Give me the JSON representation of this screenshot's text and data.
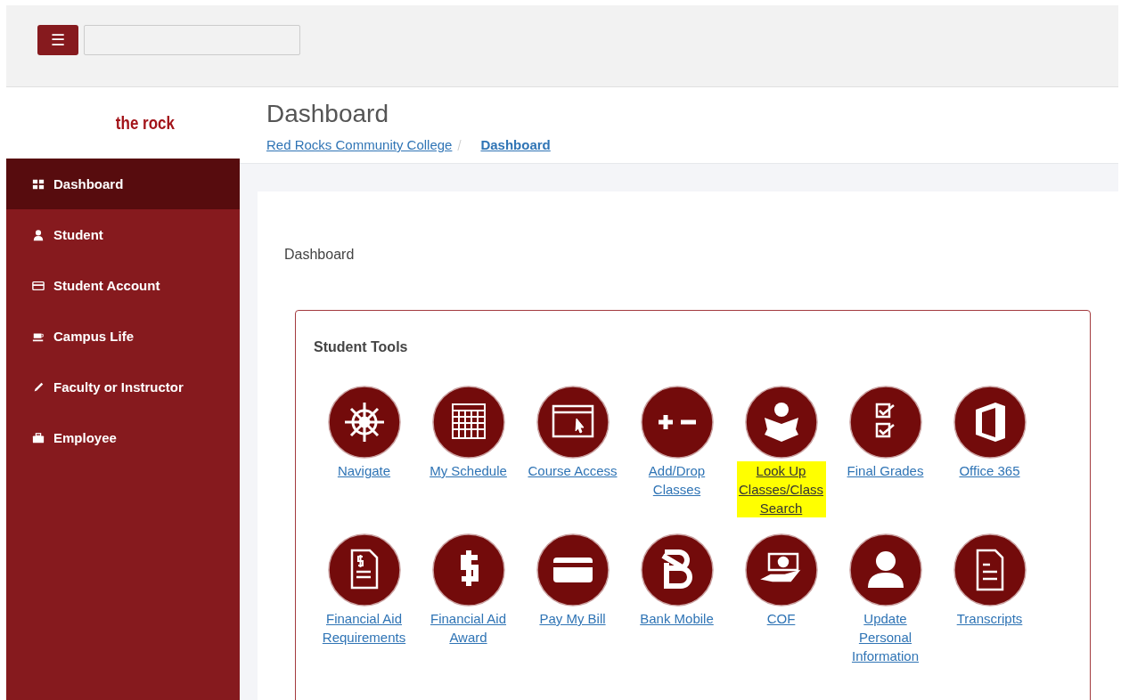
{
  "header": {
    "menu_button": "☰"
  },
  "logo": "the rock",
  "page": {
    "title": "Dashboard",
    "breadcrumbs": [
      {
        "label": "Red Rocks Community College",
        "current": false
      },
      {
        "label": "Dashboard",
        "current": true
      }
    ]
  },
  "sidebar": {
    "items": [
      {
        "label": "Dashboard",
        "kind": "grid",
        "selected": true
      },
      {
        "label": "Student",
        "kind": "person",
        "selected": false
      },
      {
        "label": "Student Account",
        "kind": "card",
        "selected": false
      },
      {
        "label": "Campus Life",
        "kind": "cup",
        "selected": false
      },
      {
        "label": "Faculty or Instructor",
        "kind": "pencil",
        "selected": false
      },
      {
        "label": "Employee",
        "kind": "briefcase",
        "selected": false
      }
    ]
  },
  "section_label": "Dashboard",
  "panel": {
    "title": "Student Tools",
    "tools": [
      {
        "label": "Navigate",
        "kind": "wheel",
        "highlighted": false
      },
      {
        "label": "My Schedule",
        "kind": "calendar",
        "highlighted": false
      },
      {
        "label": "Course Access",
        "kind": "window",
        "highlighted": false
      },
      {
        "label": "Add/Drop Classes",
        "kind": "plusminus",
        "highlighted": false
      },
      {
        "label": "Look Up Classes/Class Search",
        "kind": "reader",
        "highlighted": true
      },
      {
        "label": "Final Grades",
        "kind": "checklist",
        "highlighted": false
      },
      {
        "label": "Office 365",
        "kind": "office",
        "highlighted": false
      },
      {
        "label": "Financial Aid Requirements",
        "kind": "dollardoc",
        "highlighted": false
      },
      {
        "label": "Financial Aid Award",
        "kind": "dollar",
        "highlighted": false
      },
      {
        "label": "Pay My Bill",
        "kind": "card",
        "highlighted": false
      },
      {
        "label": "Bank Mobile",
        "kind": "b",
        "highlighted": false
      },
      {
        "label": "COF",
        "kind": "hand",
        "highlighted": false
      },
      {
        "label": "Update Personal Information",
        "kind": "user",
        "highlighted": false
      },
      {
        "label": "Transcripts",
        "kind": "doc",
        "highlighted": false
      }
    ]
  }
}
